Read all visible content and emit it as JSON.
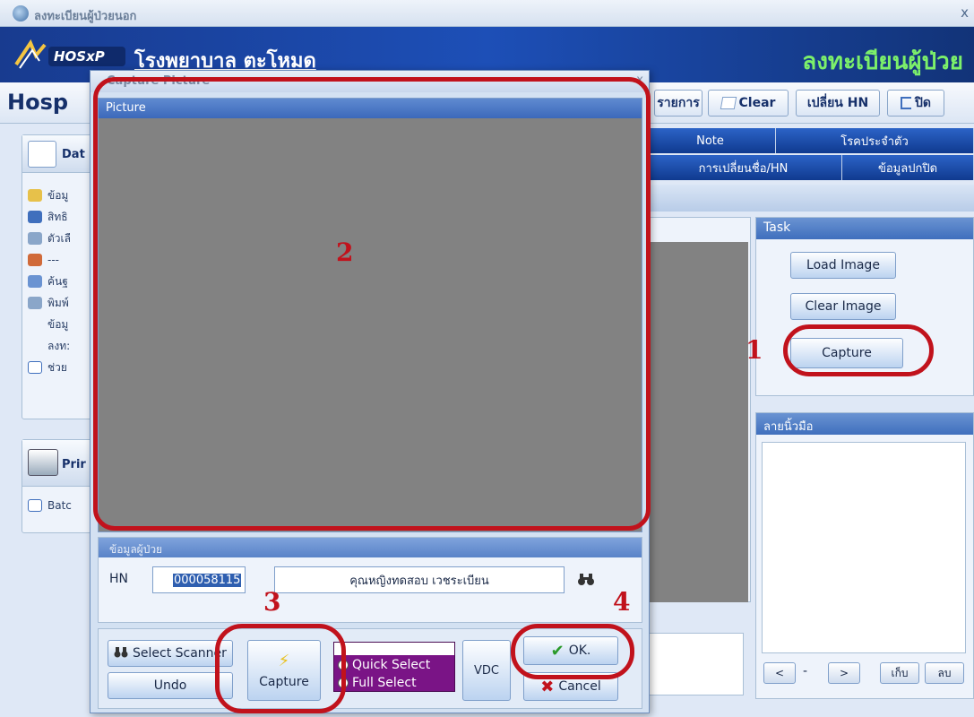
{
  "window": {
    "title": "ลงทะเบียนผู้ป่วยนอก",
    "close": "x"
  },
  "banner": {
    "logo_text": "HOSxP",
    "hospital": "โรงพยาบาล ตะโหมด",
    "module": "ลงทะเบียนผู้ป่วย"
  },
  "toolbar": {
    "title": "Hosp",
    "items": [
      {
        "label": "รายการ"
      },
      {
        "label": "Clear"
      },
      {
        "label": "เปลี่ยน HN"
      },
      {
        "label": "ปิด"
      }
    ]
  },
  "left_panel": {
    "header": "Dat",
    "items": [
      "ข้อมู",
      "สิทธิ",
      "ตัวเลื",
      "---",
      "ค้นฐ",
      "พิมพ์",
      "ข้อมู",
      "ลงท:",
      "ช่วย"
    ],
    "print_header": "Prir",
    "print_item": "Batc"
  },
  "tabs_row1": [
    "Note",
    "โรคประจำตัว"
  ],
  "tabs_row2": [
    "การเปลี่ยนชื่อ/HN",
    "ข้อมูลปกปิด"
  ],
  "task": {
    "header": "Task",
    "buttons": [
      "Load Image",
      "Clear Image",
      "Capture"
    ]
  },
  "fingerprint": {
    "header": "ลายนิ้วมือ",
    "nav_prev": "<",
    "nav_sep": "-",
    "nav_next": ">",
    "save": "เก็บ",
    "delete": "ลบ"
  },
  "dialog": {
    "title": "Capture Picture",
    "close": "x",
    "picture_header": "Picture",
    "info_header": "ข้อมูลผู้ป่วย",
    "hn_label": "HN",
    "hn_value": "000058115",
    "patient_name": "คุณหญิงทดสอบ เวชระเบียน",
    "buttons": {
      "select_scanner": "Select Scanner",
      "undo": "Undo",
      "capture": "Capture",
      "quick_select": "Quick Select",
      "full_select": "Full Select",
      "vdc": "VDC",
      "ok": "OK.",
      "cancel": "Cancel"
    }
  },
  "annotations": [
    "1",
    "2",
    "3",
    "4"
  ],
  "colors": {
    "annotation": "#c1121c",
    "banner": "#1d4fb7",
    "module_title": "#7cf06a"
  }
}
